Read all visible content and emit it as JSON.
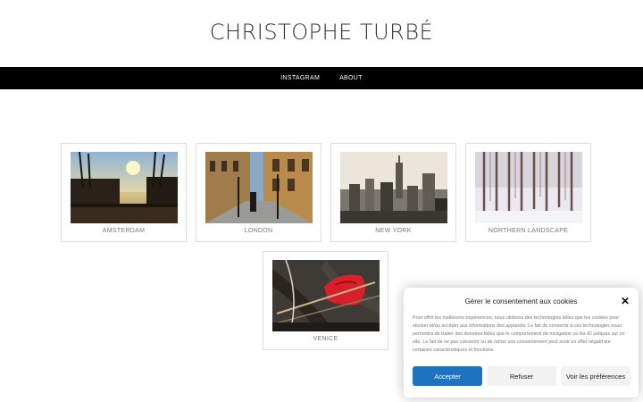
{
  "site": {
    "title": "CHRISTOPHE TURBÉ"
  },
  "nav": {
    "items": [
      {
        "label": "INSTAGRAM"
      },
      {
        "label": "ABOUT"
      }
    ]
  },
  "gallery": {
    "items": [
      {
        "caption": "AMSTERDAM"
      },
      {
        "caption": "LONDON"
      },
      {
        "caption": "NEW YORK"
      },
      {
        "caption": "NORTHERN LANDSCAPE"
      },
      {
        "caption": "VENICE"
      }
    ]
  },
  "cookie_banner": {
    "title": "Gérer le consentement aux cookies",
    "text": "Pour offrir les meilleures expériences, nous utilisons des technologies telles que les cookies pour stocker et/ou accéder aux informations des appareils. Le fait de consentir à ces technologies nous permettra de traiter des données telles que le comportement de navigation ou les ID uniques sur ce site. Le fait de ne pas consentir ou de retirer son consentement peut avoir un effet négatif sur certaines caractéristiques et fonctions.",
    "accept_label": "Accepter",
    "refuse_label": "Refuser",
    "preferences_label": "Voir les préférences",
    "accent_color": "#1e73be"
  }
}
